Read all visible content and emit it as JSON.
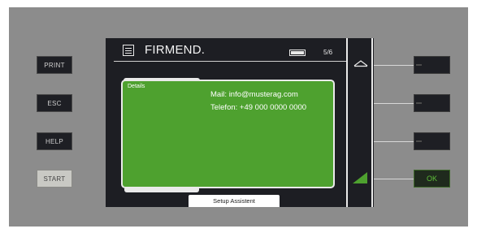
{
  "left_keys": [
    {
      "label": "PRINT"
    },
    {
      "label": "ESC"
    },
    {
      "label": "HELP"
    },
    {
      "label": "START"
    }
  ],
  "screen": {
    "title": "FIRMEND.",
    "page_indicator": "5/6",
    "menu_icon": "menu-list-icon",
    "battery_icon": "battery-icon",
    "section_label": "Details",
    "mail": "Mail: info@musterag.com",
    "phone": "Telefon: +49 000 0000 0000",
    "bottom_tab": "Setup Assistent"
  },
  "right_keys": [
    {
      "label": ""
    },
    {
      "label": ""
    },
    {
      "label": ""
    },
    {
      "label": "OK"
    }
  ],
  "icons": {
    "scroll_up": "scroll-up-icon",
    "scroll_indicator": "scroll-indicator-icon"
  },
  "colors": {
    "content_green": "#4ea12f",
    "ok_green": "#5fc03a",
    "screen_bg": "#1d1e23"
  }
}
